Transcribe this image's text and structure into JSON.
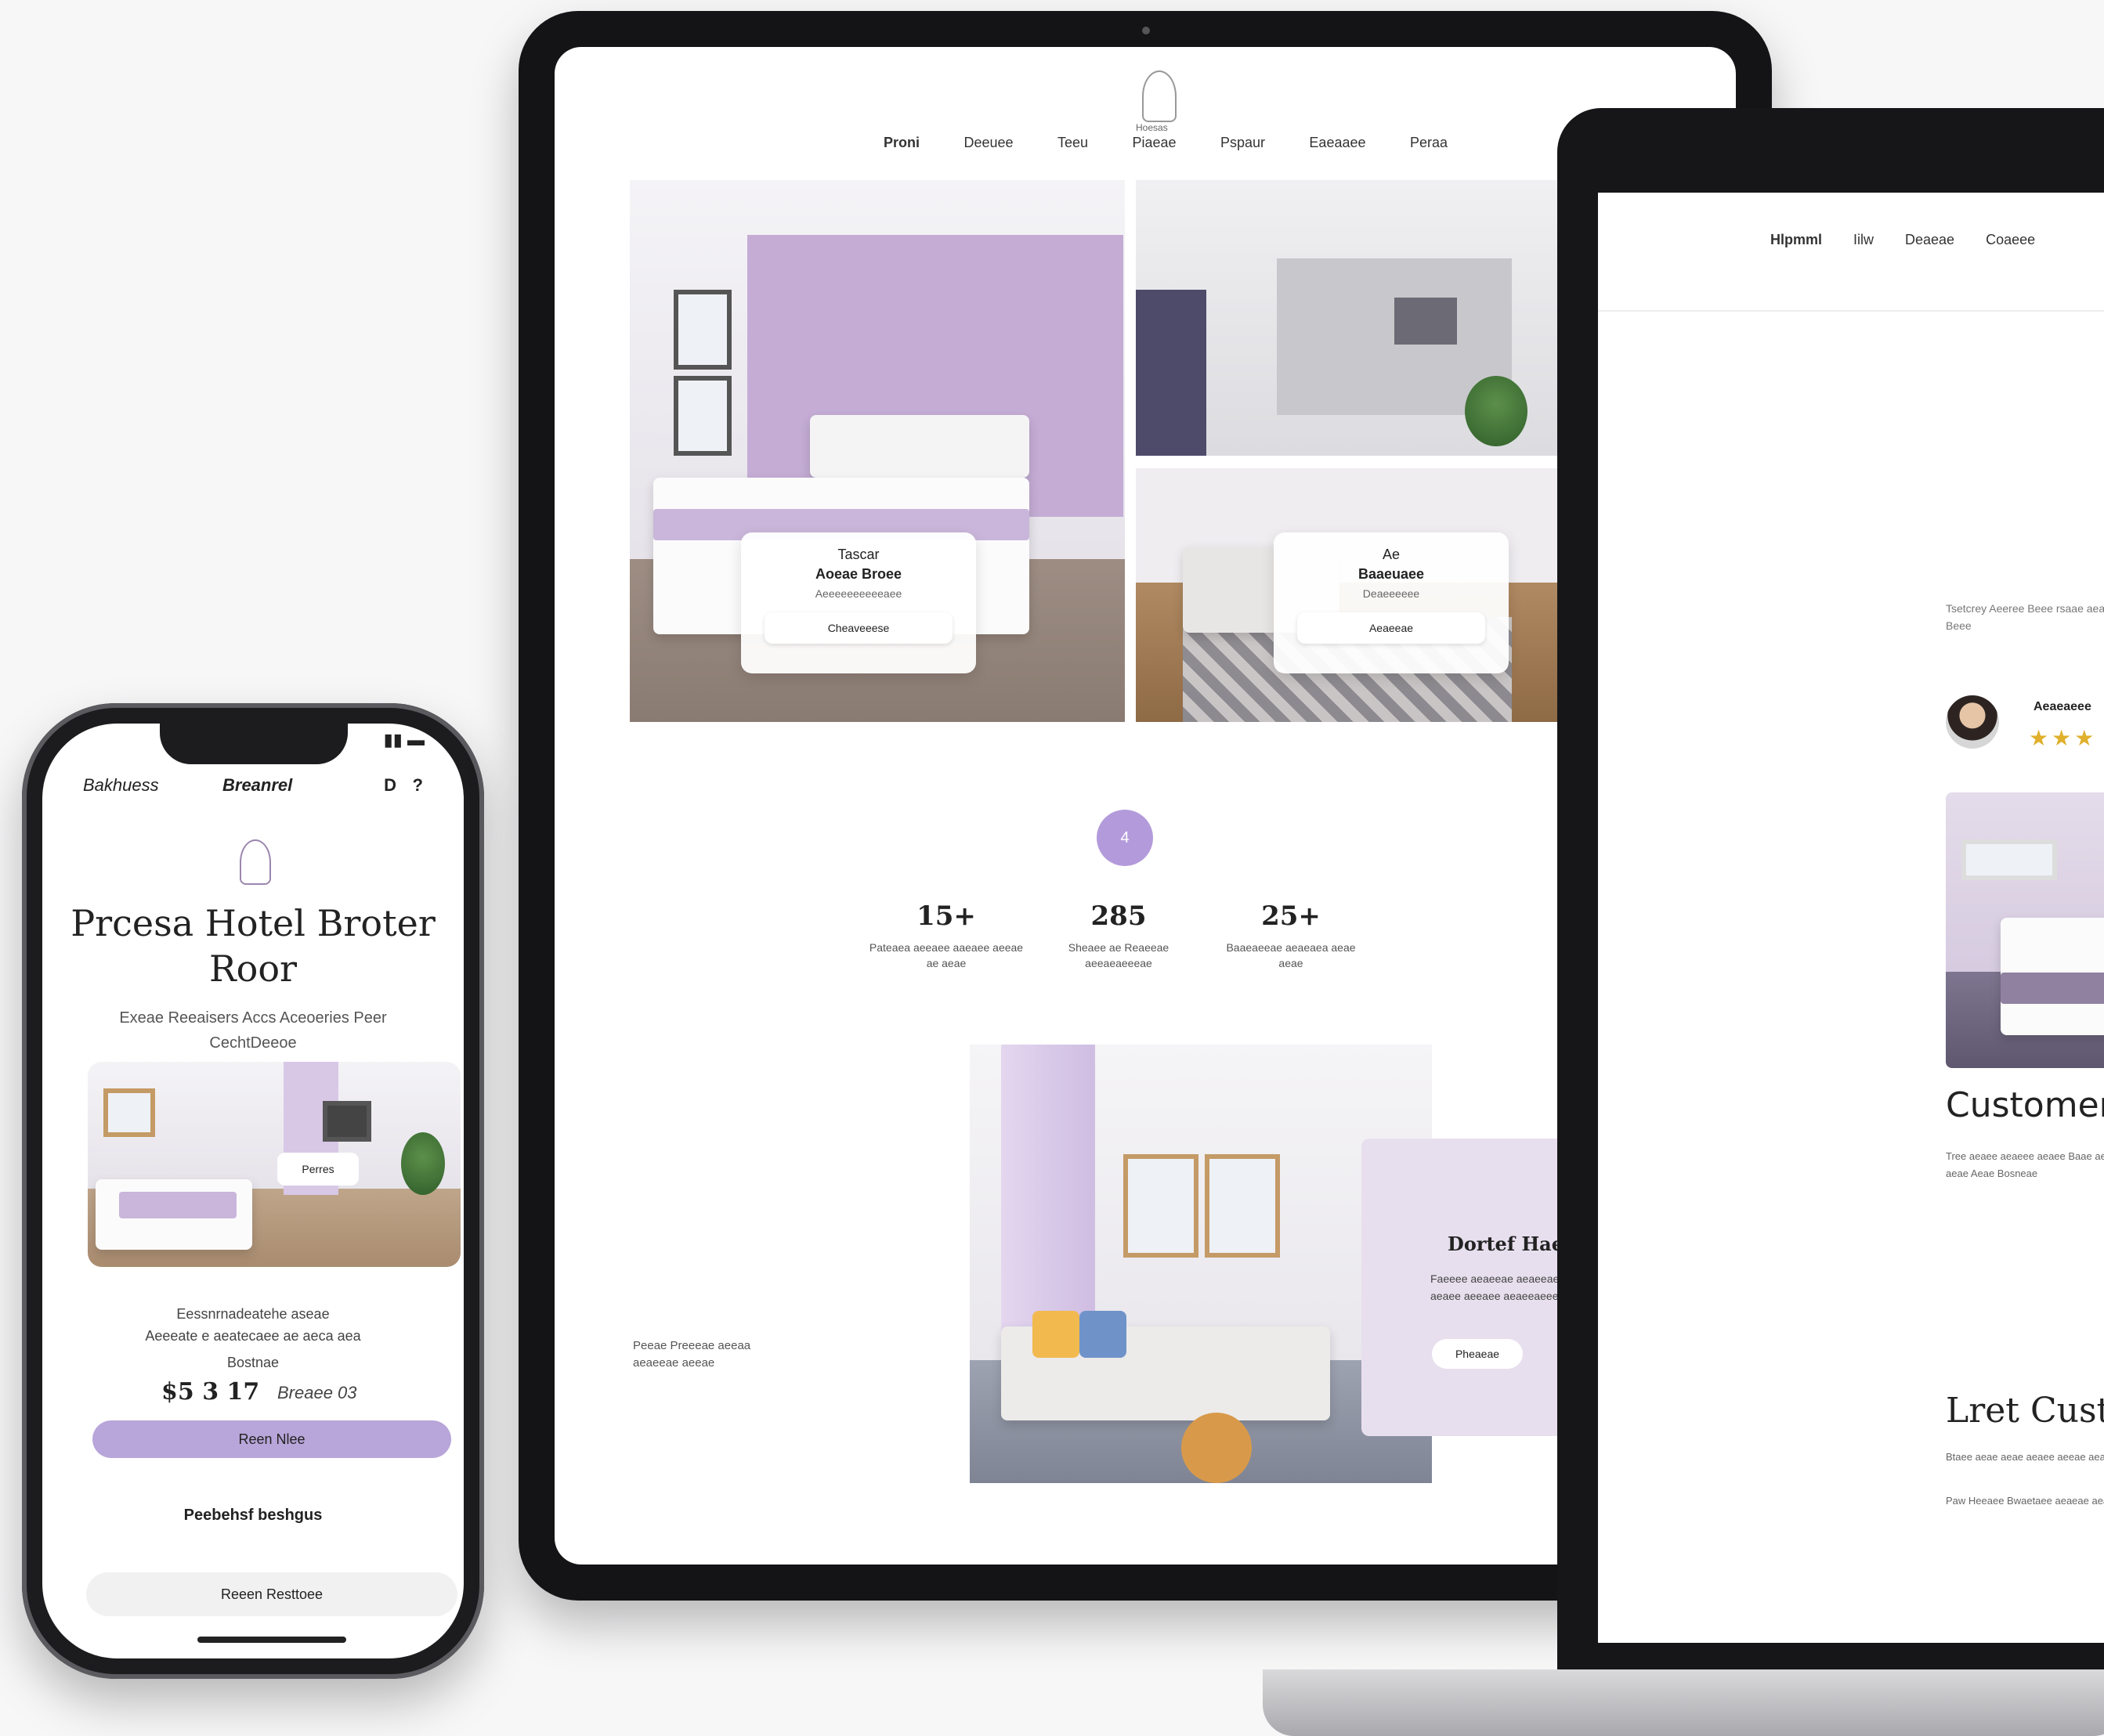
{
  "colors": {
    "accent": "#b39bdb",
    "lavender": "#c9b6da",
    "background": "#f7f7f8"
  },
  "phone": {
    "status_icons": "▮▮ ▬",
    "nav": {
      "left": "Bakhuess",
      "center": "Breanrel",
      "icon_left": "D",
      "icon_right": "?"
    },
    "title": "Prcesa Hotel Broter Roor",
    "subtitle": "Exeae Reeaisers Accs Aceoeries Peer CechtDeeoe",
    "image_button": "Perres",
    "info_line1": "Eessnrnadeatehe aseae",
    "info_line2": "Aeeeate e aeatecaee ae aeca aea",
    "info_line3": "Bostnae",
    "price": "$5 3 17",
    "price_suffix": "Breaee 03",
    "book_button": "Reen Nlee",
    "featured": "Peebehsf beshgus",
    "explore_button": "Reeen Resttoee"
  },
  "tablet": {
    "logo_text": "Hoesas",
    "nav": [
      "Proni",
      "Deeuee",
      "Teeu",
      "Piaeae",
      "Pspaur",
      "Eaeaaee",
      "Peraa"
    ],
    "card1": {
      "line1": "Tascar",
      "title": "Aoeae Broee",
      "sub": "Aeeeeeeeeeeaee",
      "button": "Cheaveeese"
    },
    "card2": {
      "line1": "Ae",
      "title": "Baaeuaee",
      "sub": "Deaeeeeee",
      "button": "Aeaeeae"
    },
    "circle_label": "4",
    "stats": [
      {
        "num": "15+",
        "desc": "Pateaea aeeaee aaeaee aeeae ae aeae"
      },
      {
        "num": "285",
        "desc": "Sheaee ae Reaeeae aeeaeaeeeae"
      },
      {
        "num": "25+",
        "desc": "Baaeaeeae aeaeaea aeae aeae"
      }
    ],
    "side_text": "Peeae Preeeae aeeaa aeaeeae aeeae",
    "promo": {
      "title": "Dortef Haeat Ya",
      "text": "Faeeee aeaeeae aeaeeae aeae aeaee aeeaee aeaeeaeeee aeeae",
      "button": "Pheaeae"
    }
  },
  "laptop": {
    "nav": [
      "Hlpmml",
      "Iilw",
      "Deaeae",
      "Coaeee"
    ],
    "para": "Tsetcrey Aeeree Beee rsaae aeaeeee ae ae Reeaee aeaeae Beee",
    "reviewer": "Aeaeaeee",
    "stars": "★★★",
    "heading1": "Customer",
    "text1": "Tree aeaee aeaeee aeaee Baae aeaee aeaee aeae aeaae aeeae ae aeae Aeae Bosneae",
    "heading2": "Lret Cust",
    "text2": "Btaee aeae aeae aeaee aeeae aeaeae",
    "text3": "Paw Heeaee Bwaetaee aeaeae aeae aeaeeae"
  }
}
